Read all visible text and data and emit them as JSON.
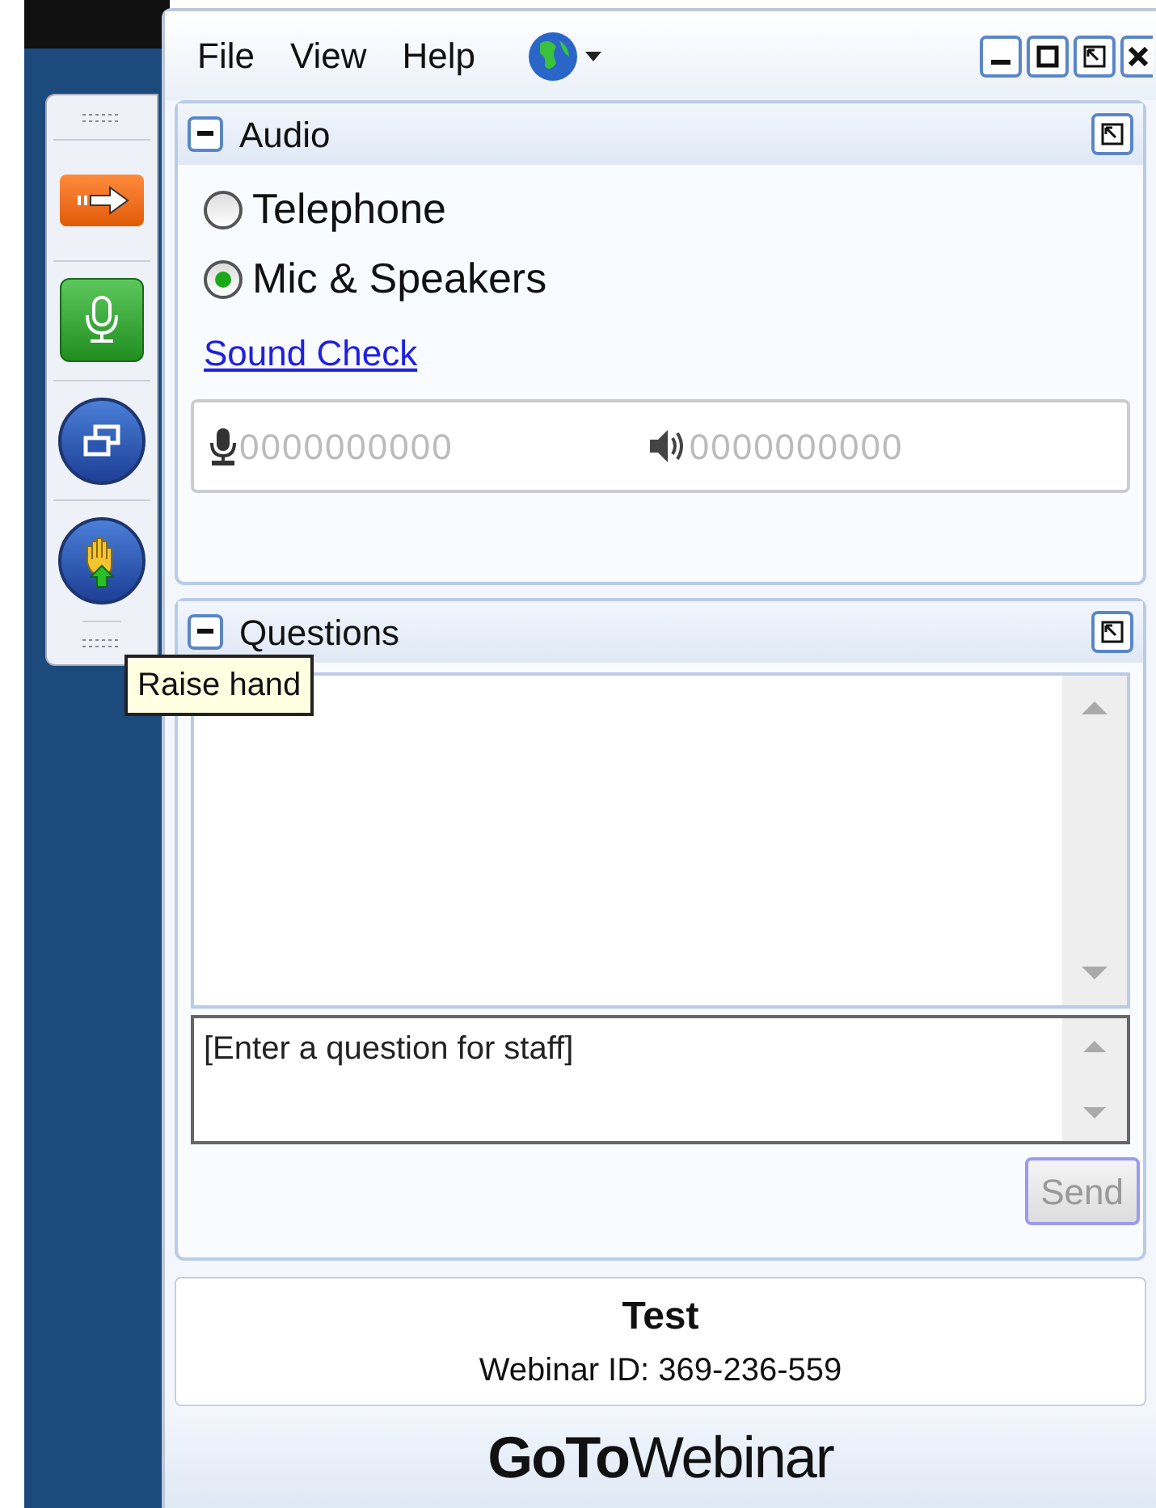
{
  "menu": [
    "File",
    "View",
    "Help"
  ],
  "toolbar": [
    {
      "kind": "arrow",
      "selected": false
    },
    {
      "kind": "mic",
      "selected": false
    },
    {
      "kind": "windows",
      "selected": false
    },
    {
      "kind": "hand",
      "selected": false
    }
  ],
  "tooltip": "Raise hand",
  "audio": {
    "title": "Audio",
    "options": [
      {
        "label": "Telephone",
        "selected": false
      },
      {
        "label": "Mic & Speakers",
        "selected": true
      }
    ],
    "link": "Sound Check",
    "mic_reading": "0000000000",
    "speaker_reading": "0000000000"
  },
  "questions": {
    "title": "Questions",
    "input": {
      "placeholder": "[Enter a question for staff]"
    },
    "send": {
      "label": "Send",
      "disabled": true
    }
  },
  "info": {
    "title": "Test",
    "webinar_id": "Webinar ID: 369-236-559"
  },
  "logo": "**GoTo**Webinar"
}
